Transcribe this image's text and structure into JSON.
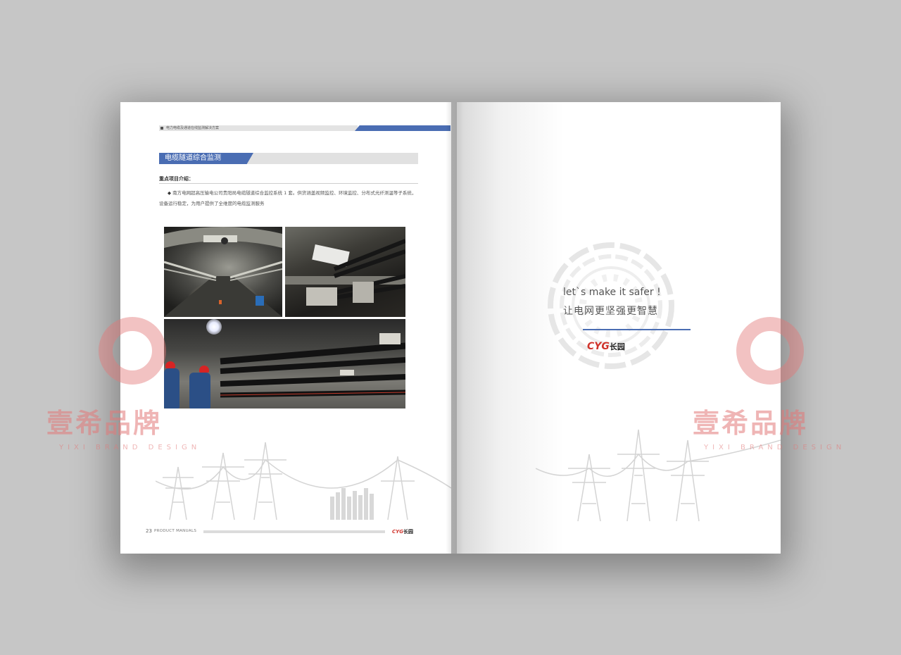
{
  "left_page": {
    "header_text": "电力电缆及通道在线监测解决方案",
    "section_title": "电缆隧道综合监测",
    "subtitle": "重点项目介绍：",
    "bullet": "◆",
    "paragraph": "南方电网超高压输电公司贵阳局电缆隧道综合监控系统 1 套。供货涵盖视频监控、环境监控、分布式光纤测温等子系统，设备运行稳定，为用户提供了全维度的电缆监测服务",
    "footer": {
      "page_number": "23",
      "label": "PRODUCT MANUALS",
      "logo_latin": "CYG",
      "logo_cn": "长园"
    }
  },
  "right_page": {
    "slogan_en": "let`s make it safer !",
    "slogan_cn": "让电网更坚强更智慧",
    "logo_latin": "CYG",
    "logo_cn": "长园"
  },
  "watermark": {
    "text": "壹希品牌",
    "sub": "YIXI BRAND DESIGN"
  },
  "colors": {
    "accent_blue": "#4a6db3",
    "brand_red": "#d0342c",
    "background": "#c6c6c6"
  }
}
